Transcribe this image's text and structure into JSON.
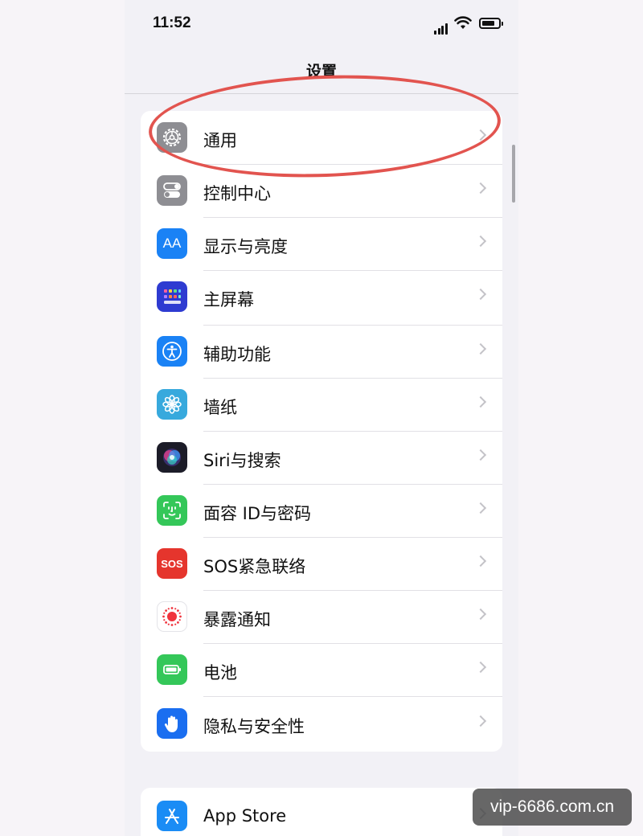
{
  "status_bar": {
    "time": "11:52"
  },
  "nav": {
    "title": "设置"
  },
  "settings_group": {
    "items": [
      {
        "label": "通用",
        "icon": "gear-icon",
        "color": "#8e8e93"
      },
      {
        "label": "控制中心",
        "icon": "toggle-switches-icon",
        "color": "#8e8e93"
      },
      {
        "label": "显示与亮度",
        "icon": "text-size-icon",
        "icon_text": "AA",
        "color": "#1a82f5"
      },
      {
        "label": "主屏幕",
        "icon": "home-screen-grid-icon",
        "color": "#2e3bd1"
      },
      {
        "label": "辅助功能",
        "icon": "accessibility-icon",
        "color": "#1a82f5"
      },
      {
        "label": "墙纸",
        "icon": "flower-icon",
        "color": "#37a9dd"
      },
      {
        "label": "Siri与搜索",
        "icon": "siri-icon",
        "color": "#1c1c28"
      },
      {
        "label": "面容 ID与密码",
        "icon": "face-id-icon",
        "color": "#34c759"
      },
      {
        "label": "SOS紧急联络",
        "icon": "sos-icon",
        "icon_text": "SOS",
        "color": "#e5352d"
      },
      {
        "label": "暴露通知",
        "icon": "exposure-notification-icon",
        "color": "#ffffff"
      },
      {
        "label": "电池",
        "icon": "battery-icon",
        "color": "#34c759"
      },
      {
        "label": "隐私与安全性",
        "icon": "hand-icon",
        "color": "#1a6ef0"
      }
    ]
  },
  "store_group": {
    "items": [
      {
        "label": "App Store",
        "icon": "app-store-icon",
        "color": "#1a8cf5"
      }
    ]
  },
  "watermark": {
    "text": "vip-6686.com.cn"
  }
}
